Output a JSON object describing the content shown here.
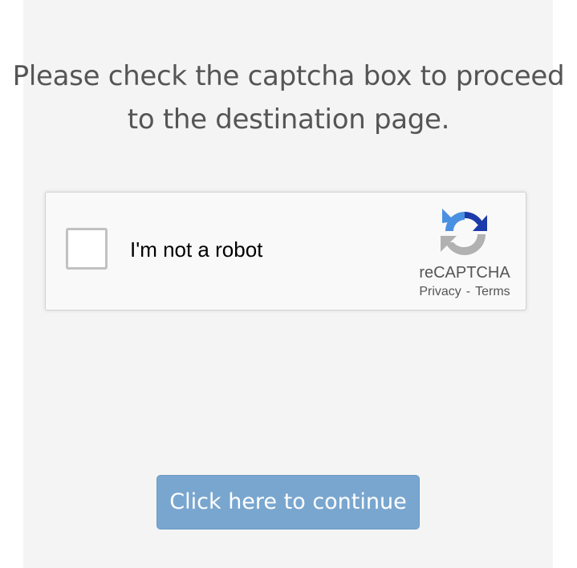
{
  "heading": {
    "line1": "Please check the captcha box to proceed",
    "line2": "to the destination page."
  },
  "captcha": {
    "checkbox_label": "I'm not a robot",
    "checked": false,
    "brand": "reCAPTCHA",
    "privacy_link": "Privacy",
    "separator": "-",
    "terms_link": "Terms",
    "logo_icon": "recaptcha-logo-icon",
    "colors": {
      "logo_blue_light": "#4a90e2",
      "logo_blue_dark": "#1c3aa9",
      "logo_gray": "#b1b1b1"
    }
  },
  "continue_button": {
    "label": "Click here to continue",
    "color": "#79a6cf"
  }
}
